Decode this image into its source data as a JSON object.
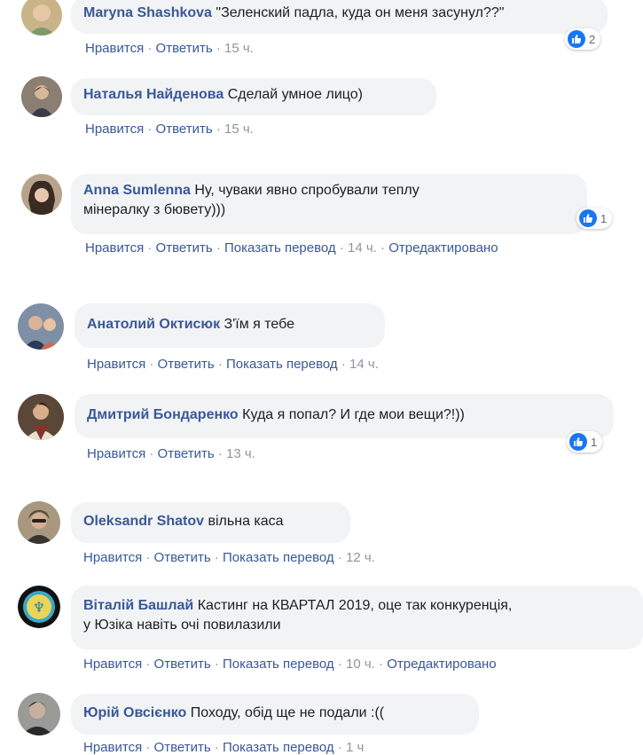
{
  "actions": {
    "like": "Нравится",
    "reply": "Ответить",
    "translate": "Показать перевод",
    "edited": "Отредактировано",
    "dot": "·"
  },
  "comments": [
    {
      "author": "Maryna Shashkova",
      "text": "\"Зеленский падла, куда он меня засунул??\"",
      "time": "15 ч.",
      "likes": "2"
    },
    {
      "author": "Наталья Найденова",
      "text": "Сделай умное лицо)",
      "time": "15 ч."
    },
    {
      "author": "Anna Sumlenna",
      "text_line1": "Ну, чуваки явно спробували теплу",
      "text_line2": "мінералку з бювету)))",
      "time": "14 ч.",
      "likes": "1"
    },
    {
      "author": "Анатолий Октисюк",
      "text": "З'їм я тебе",
      "time": "14 ч."
    },
    {
      "author": "Дмитрий Бондаренко",
      "text": "Куда я попал? И где мои вещи?!))",
      "time": "13 ч.",
      "likes": "1"
    },
    {
      "author": "Oleksandr Shatov",
      "text": "вільна каса",
      "time": "12 ч."
    },
    {
      "author": "Віталій Башлай",
      "text_line1": "Кастинг на КВАРТАЛ 2019, оце так конкуренція,",
      "text_line2": "у Юзіка навіть очі повилазили",
      "time": "10 ч."
    },
    {
      "author": "Юрій Овсієнко",
      "text": "Походу, обід ще не подали :((",
      "time": "1 ч"
    }
  ]
}
